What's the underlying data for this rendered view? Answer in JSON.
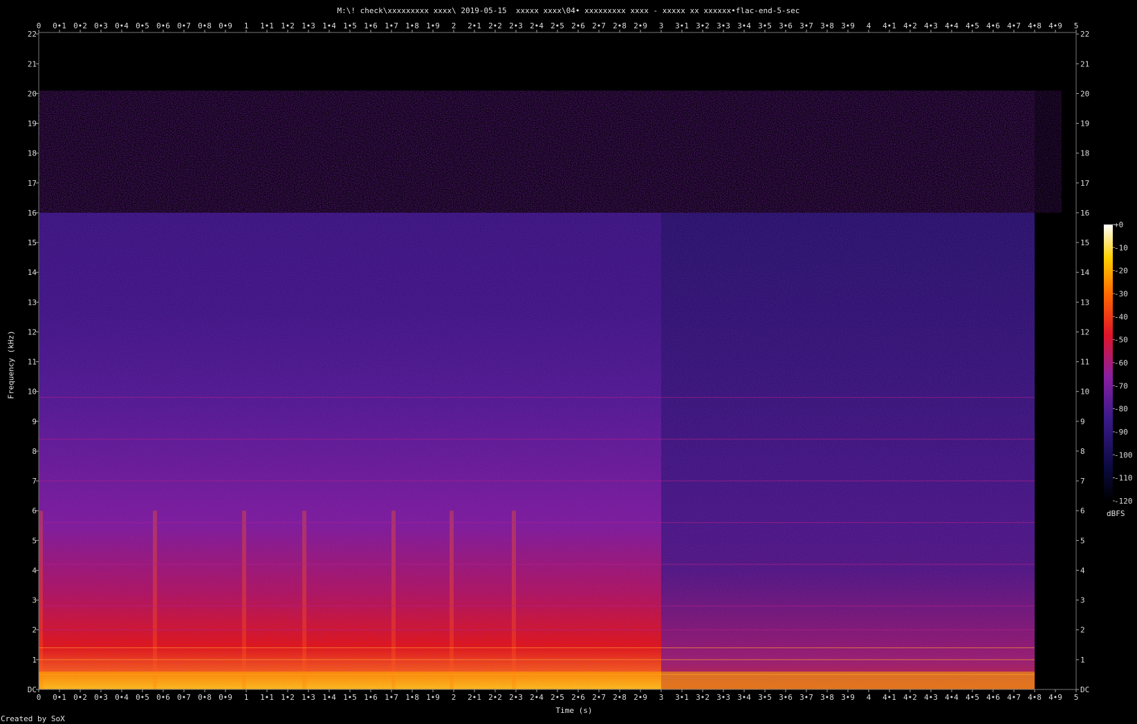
{
  "title": "M:\\! check\\xxxxxxxxx xxxx\\ 2019-05-15  xxxxx xxxx\\04• xxxxxxxxx xxxx - xxxxx xx xxxxxx•flac-end-5-sec",
  "credit": "Created by SoX",
  "chart_data": {
    "type": "heatmap",
    "title": "M:\\! check\\xxxxxxxxx xxxx\\ 2019-05-15  xxxxx xxxx\\04• xxxxxxxxx xxxx - xxxxx xx xxxxxx•flac-end-5-sec",
    "xlabel": "Time (s)",
    "ylabel": "Frequency (kHz)",
    "xlim": [
      0,
      5
    ],
    "ylim": [
      0,
      22.05
    ],
    "x_ticks": [
      "0",
      "0•1",
      "0•2",
      "0•3",
      "0•4",
      "0•5",
      "0•6",
      "0•7",
      "0•8",
      "0•9",
      "1",
      "1•1",
      "1•2",
      "1•3",
      "1•4",
      "1•5",
      "1•6",
      "1•7",
      "1•8",
      "1•9",
      "2",
      "2•1",
      "2•2",
      "2•3",
      "2•4",
      "2•5",
      "2•6",
      "2•7",
      "2•8",
      "2•9",
      "3",
      "3•1",
      "3•2",
      "3•3",
      "3•4",
      "3•5",
      "3•6",
      "3•7",
      "3•8",
      "3•9",
      "4",
      "4•1",
      "4•2",
      "4•3",
      "4•4",
      "4•5",
      "4•6",
      "4•7",
      "4•8",
      "4•9",
      "5"
    ],
    "y_ticks": [
      "DC",
      "1",
      "2",
      "3",
      "4",
      "5",
      "6",
      "7",
      "8",
      "9",
      "10",
      "11",
      "12",
      "13",
      "14",
      "15",
      "16",
      "17",
      "18",
      "19",
      "20",
      "21",
      "22"
    ],
    "colorbar": {
      "label": "dBFS",
      "ticks": [
        "+0",
        "-10",
        "-20",
        "-30",
        "-40",
        "-50",
        "-60",
        "-70",
        "-80",
        "-90",
        "-100",
        "-110",
        "-120"
      ],
      "range": [
        -120,
        0
      ]
    },
    "features": {
      "cutoff_khz": 16,
      "sparse_band_khz": [
        16,
        20.1
      ],
      "audio_end_s": 4.8,
      "bright_onsets_s": [
        0,
        0.55,
        0.98,
        1.27,
        1.7,
        1.98,
        2.28
      ],
      "tonal_lines_khz": [
        0.5,
        1.0,
        1.4,
        2.0,
        2.8,
        4.2,
        5.6,
        7.0,
        8.4,
        9.8
      ]
    },
    "colors": {
      "background": "#000000",
      "low": "#0a0a40",
      "mid": "#6a1fa0",
      "high": "#e01a0a",
      "peak": "#ffffe0"
    }
  }
}
